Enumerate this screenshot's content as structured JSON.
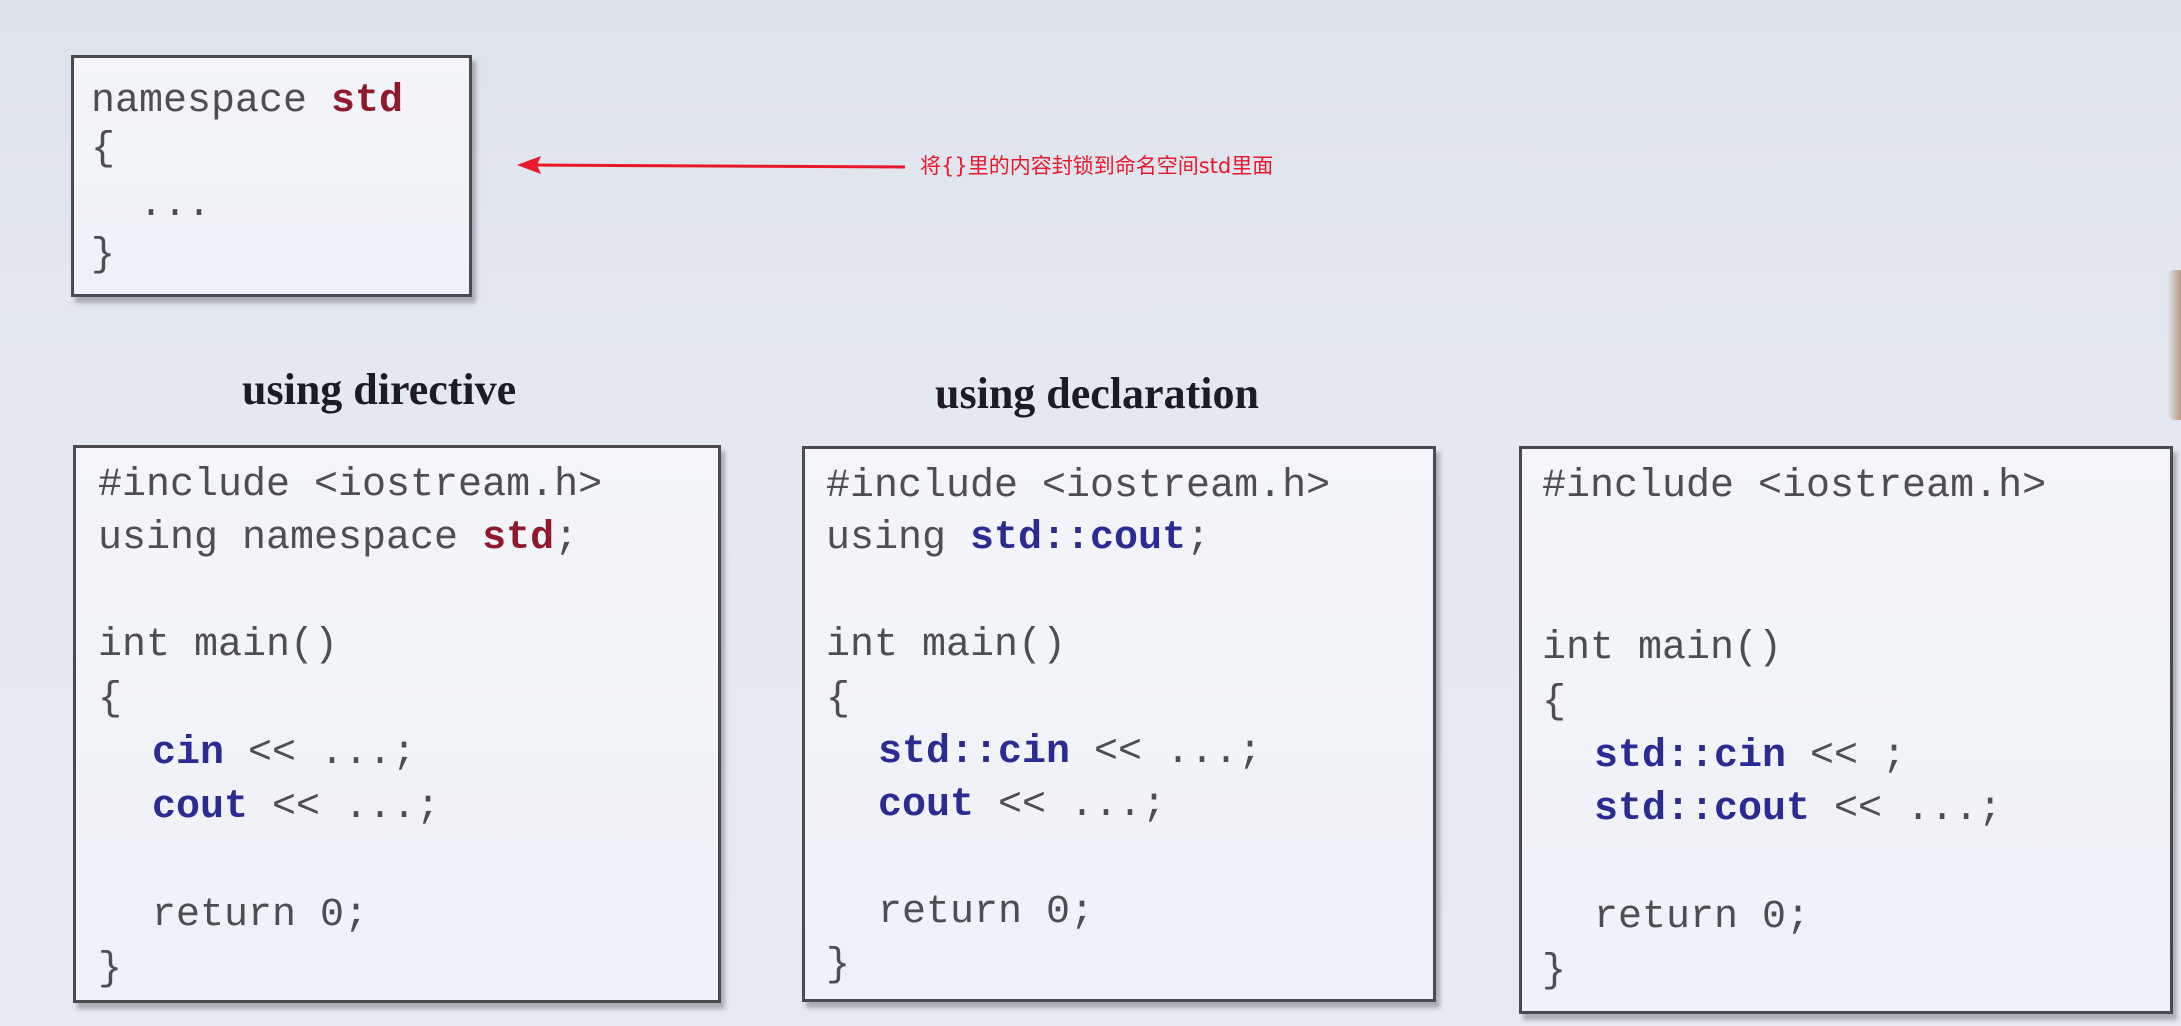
{
  "annotation": {
    "note": "将{}里的内容封锁到命名空间std里面"
  },
  "namespace_box": {
    "line1_prefix": "namespace ",
    "line1_keyword": "std",
    "line2": "{",
    "line3": "  ...",
    "line4": "}"
  },
  "headings": {
    "directive": "using directive",
    "declaration": "using declaration"
  },
  "panel_directive": {
    "include": "#include <iostream.h>",
    "using_prefix": "using namespace ",
    "using_keyword": "std",
    "using_suffix": ";",
    "main_sig": "int main()",
    "open_brace": "{",
    "stmt1_kw": "cin",
    "stmt1_rest": " << ...;",
    "stmt2_kw": "cout",
    "stmt2_rest": " << ...;",
    "ret": "return 0;",
    "close_brace": "}"
  },
  "panel_declaration": {
    "include": "#include <iostream.h>",
    "using_prefix": "using ",
    "using_keyword": "std::cout",
    "using_suffix": ";",
    "main_sig": "int main()",
    "open_brace": "{",
    "stmt1_kw": "std::cin",
    "stmt1_rest": " << ...;",
    "stmt2_kw": "cout",
    "stmt2_rest": " << ...;",
    "ret": "return 0;",
    "close_brace": "}"
  },
  "panel_qualified": {
    "include": "#include <iostream.h>",
    "main_sig": "int main()",
    "open_brace": "{",
    "stmt1_kw": "std::cin",
    "stmt1_rest": " << ;",
    "stmt2_kw": "std::cout",
    "stmt2_rest": " << ...;",
    "ret": "return 0;",
    "close_brace": "}"
  },
  "colors": {
    "keyword_red": "#8e1a2c",
    "keyword_blue": "#2a2c92",
    "annotation_red": "#e8192a"
  }
}
